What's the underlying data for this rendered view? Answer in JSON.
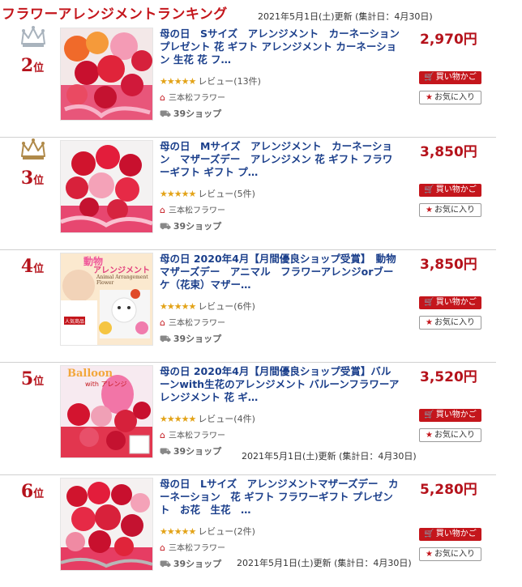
{
  "header": {
    "title": "フラワーアレンジメントランキング",
    "updated": "2021年5月1日(土)更新 (集計日：4月30日)"
  },
  "colors": {
    "brand_red": "#c4161c",
    "link_blue": "#1b3f8b",
    "star_gold": "#e3a318"
  },
  "items": [
    {
      "rank": "2",
      "rank_suffix": "位",
      "crown": "silver-crown-icon",
      "name": "母の日　Sサイズ　アレンジメント　カーネーションプレゼント 花 ギフト アレンジメント カーネーション 生花 花 フ…",
      "stars": "★★★★★",
      "review": "レビュー(13件)",
      "shop": "三本松フラワー",
      "shipping": "39ショップ",
      "price": "2,970円",
      "cart": "買い物かご",
      "favorite": "お気に入り",
      "updated": ""
    },
    {
      "rank": "3",
      "rank_suffix": "位",
      "crown": "bronze-crown-icon",
      "name": "母の日　Mサイズ　アレンジメント　カーネーション　マザーズデー　アレンジメン 花 ギフト フラワーギフト ギフト プ…",
      "stars": "★★★★★",
      "review": "レビュー(5件)",
      "shop": "三本松フラワー",
      "shipping": "39ショップ",
      "price": "3,850円",
      "cart": "買い物かご",
      "favorite": "お気に入り",
      "updated": ""
    },
    {
      "rank": "4",
      "rank_suffix": "位",
      "crown": "",
      "name": "母の日 2020年4月【月間優良ショップ受賞】　動物マザーズデー　アニマル　フラワーアレンジorブーケ（花束）マザー…",
      "stars": "★★★★★",
      "review": "レビュー(6件)",
      "shop": "三本松フラワー",
      "shipping": "39ショップ",
      "price": "3,850円",
      "cart": "買い物かご",
      "favorite": "お気に入り",
      "updated": "",
      "thumb_text1": "動物",
      "thumb_text2": "アレンジメント",
      "thumb_text3": "Animal Arrangement Flower",
      "thumb_badge": "人気商品"
    },
    {
      "rank": "5",
      "rank_suffix": "位",
      "crown": "",
      "name": "母の日 2020年4月【月間優良ショップ受賞】バルーンwith生花のアレンジメント バルーンフラワーアレンジメント 花 ギ…",
      "stars": "★★★★★",
      "review": "レビュー(4件)",
      "shop": "三本松フラワー",
      "shipping": "39ショップ",
      "price": "3,520円",
      "cart": "買い物かご",
      "favorite": "お気に入り",
      "updated": "2021年5月1日(土)更新 (集計日：4月30日)",
      "thumb_text1": "Balloon",
      "thumb_text2": "with アレンジ"
    },
    {
      "rank": "6",
      "rank_suffix": "位",
      "crown": "",
      "name": "母の日　Lサイズ　アレンジメントマザーズデー　カーネーション　花 ギフト フラワーギフト プレゼント　お花　生花　…",
      "stars": "★★★★★",
      "review": "レビュー(2件)",
      "shop": "三本松フラワー",
      "shipping": "39ショップ",
      "price": "5,280円",
      "cart": "買い物かご",
      "favorite": "お気に入り",
      "updated": "2021年5月1日(土)更新 (集計日：4月30日)"
    }
  ]
}
